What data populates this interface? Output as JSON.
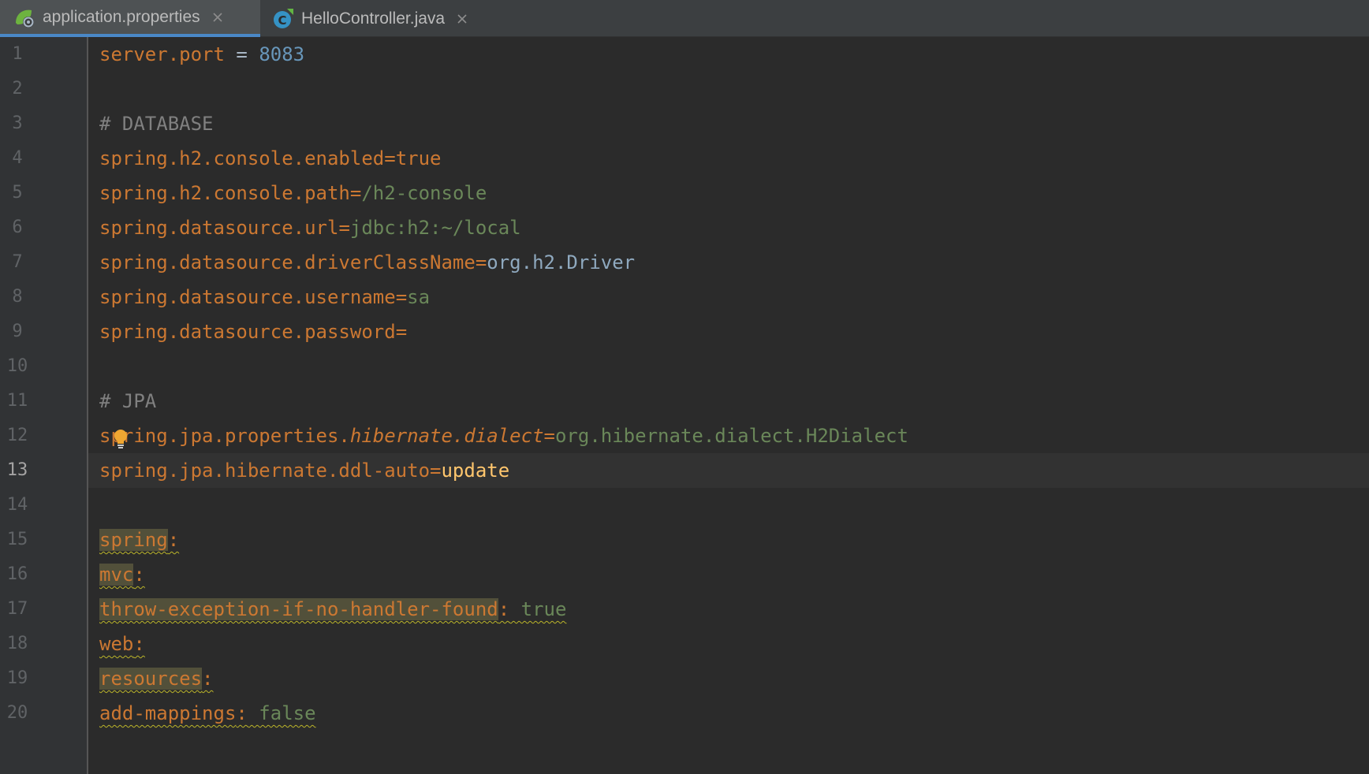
{
  "tabs": [
    {
      "label": "application.properties",
      "icon": "spring-config-icon",
      "active": true
    },
    {
      "label": "HelloController.java",
      "icon": "java-class-icon",
      "active": false
    }
  ],
  "gutter": {
    "line_numbers": [
      "1",
      "2",
      "3",
      "4",
      "5",
      "6",
      "7",
      "8",
      "9",
      "10",
      "11",
      "12",
      "13",
      "14",
      "15",
      "16",
      "17",
      "18",
      "19",
      "20"
    ],
    "current_line": "13"
  },
  "code": {
    "l1": {
      "key": "server.port",
      "eq": " = ",
      "value": "8083"
    },
    "l3": {
      "comment": "# DATABASE"
    },
    "l4": {
      "key": "spring.h2.console.enabled",
      "eq": "=",
      "value": "true"
    },
    "l5": {
      "key": "spring.h2.console.path",
      "eq": "=",
      "value": "/h2-console"
    },
    "l6": {
      "key": "spring.datasource.url",
      "eq": "=",
      "value": "jdbc:h2:~/local"
    },
    "l7": {
      "key": "spring.datasource.driverClassName",
      "eq": "=",
      "value": "org.h2.Driver"
    },
    "l8": {
      "key": "spring.datasource.username",
      "eq": "=",
      "value": "sa"
    },
    "l9": {
      "key": "spring.datasource.password",
      "eq": "="
    },
    "l11": {
      "comment": "# JPA"
    },
    "l12": {
      "key_a": "spring.jpa.properties.",
      "key_b": "hibernate.dialect",
      "eq": "=",
      "value": "org.hibernate.dialect.H2Dialect"
    },
    "l13": {
      "key": "spring.jpa.hibernate.ddl-auto",
      "eq": "=",
      "value": "update"
    },
    "l15": {
      "key": "spring",
      "colon": ":"
    },
    "l16": {
      "key": "mvc",
      "colon": ":"
    },
    "l17": {
      "key": "throw-exception-if-no-handler-found",
      "colon": ":",
      "value": " true"
    },
    "l18": {
      "key": "web",
      "colon": ":"
    },
    "l19": {
      "key": "resources",
      "colon": ":"
    },
    "l20": {
      "key": "add-mappings",
      "colon": ":",
      "value": " false"
    }
  },
  "colors": {
    "background": "#2b2b2b",
    "gutter": "#313335",
    "key": "#cc7832",
    "number": "#6897bb",
    "string_value": "#6a8759",
    "comment": "#808080",
    "active_tab_underline": "#4a88c7"
  }
}
